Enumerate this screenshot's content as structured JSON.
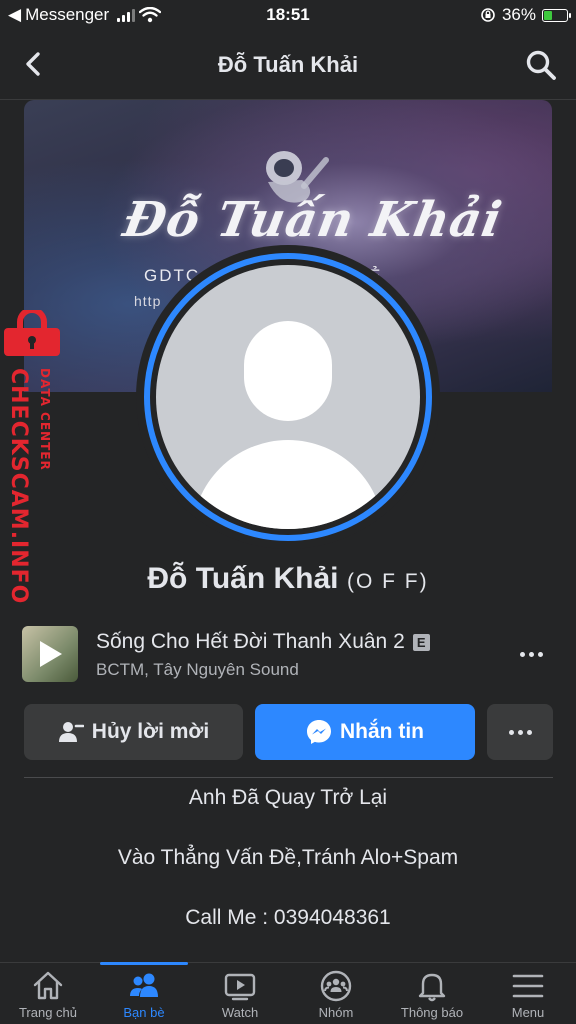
{
  "status_bar": {
    "back_app": "Messenger",
    "time": "18:51",
    "battery": "36%",
    "battery_level": 0.36
  },
  "header": {
    "title": "Đỗ Tuấn Khải"
  },
  "cover": {
    "title": "Đỗ Tuấn Khải",
    "subtitle_1": "GDTC                    Á RẺ",
    "subtitle_2": "http                                  gian"
  },
  "watermark": {
    "text": "CHECKSCAM.INFO",
    "sub": "DATA CENTER"
  },
  "profile": {
    "name": "Đỗ Tuấn Khải",
    "nickname": "(O F F)"
  },
  "music": {
    "title": "Sống Cho Hết Đời Thanh Xuân 2",
    "explicit": "E",
    "artist": "BCTM, Tây Nguyên Sound"
  },
  "actions": {
    "cancel_label": "Hủy lời mời",
    "message_label": "Nhắn tin"
  },
  "bio": {
    "line1": "Anh Đã Quay Trở Lại",
    "line2": "Vào Thẳng Vấn Đề,Tránh Alo+Spam",
    "line3": "Call Me : 0394048361"
  },
  "tabs": [
    {
      "label": "Trang chủ",
      "icon": "home-icon"
    },
    {
      "label": "Bạn bè",
      "icon": "friends-icon",
      "active": true
    },
    {
      "label": "Watch",
      "icon": "watch-icon"
    },
    {
      "label": "Nhóm",
      "icon": "groups-icon"
    },
    {
      "label": "Thông báo",
      "icon": "bell-icon"
    },
    {
      "label": "Menu",
      "icon": "menu-icon"
    }
  ],
  "colors": {
    "background": "#242526",
    "accent": "#2d88ff",
    "watermark": "#e3262f"
  }
}
